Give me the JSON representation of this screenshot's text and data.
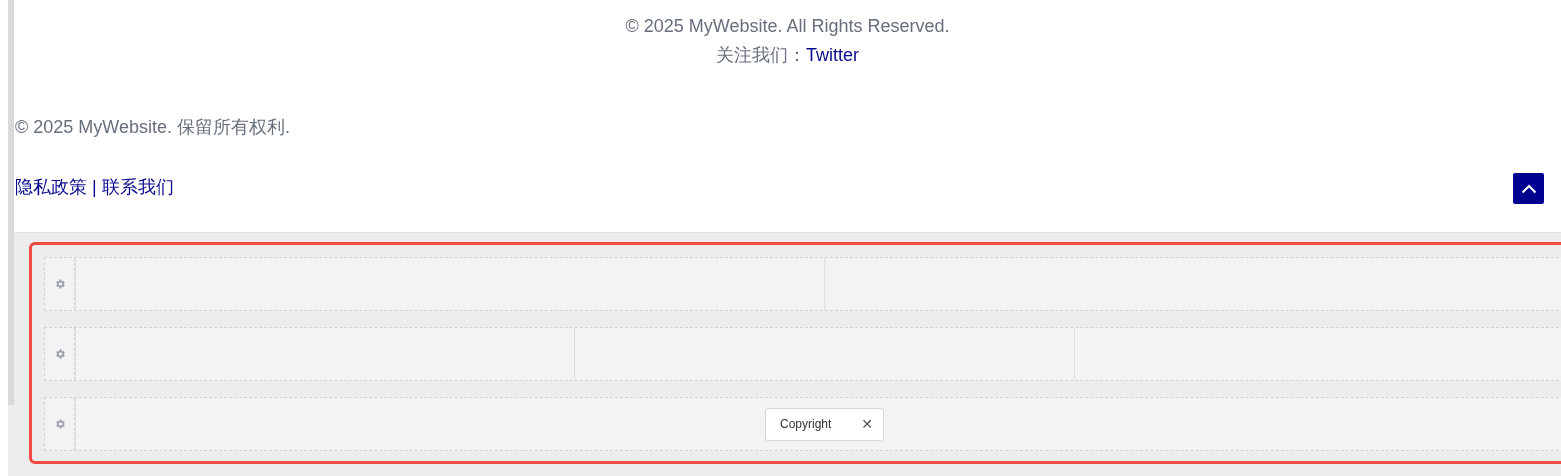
{
  "footer": {
    "lines": [
      {
        "kind": "text",
        "text": "© 2025 MyWebsite. All Rights Reserved."
      },
      {
        "kind": "follow",
        "label": "关注我们：",
        "link": "Twitter"
      }
    ],
    "copyright": "© 2025 MyWebsite. 保留所有权利.",
    "links": [
      "隐私政策",
      "联系我们"
    ],
    "separator": "|"
  },
  "builder": {
    "selected": true,
    "rows": [
      {
        "columns": [
          {
            "kind": "empty"
          },
          {
            "kind": "empty"
          }
        ]
      },
      {
        "columns": [
          {
            "kind": "empty"
          },
          {
            "kind": "empty"
          },
          {
            "kind": "empty"
          }
        ]
      },
      {
        "columns": [
          {
            "kind": "widget",
            "widget": {
              "label": "Copyright",
              "close": "✕"
            }
          }
        ]
      }
    ]
  }
}
